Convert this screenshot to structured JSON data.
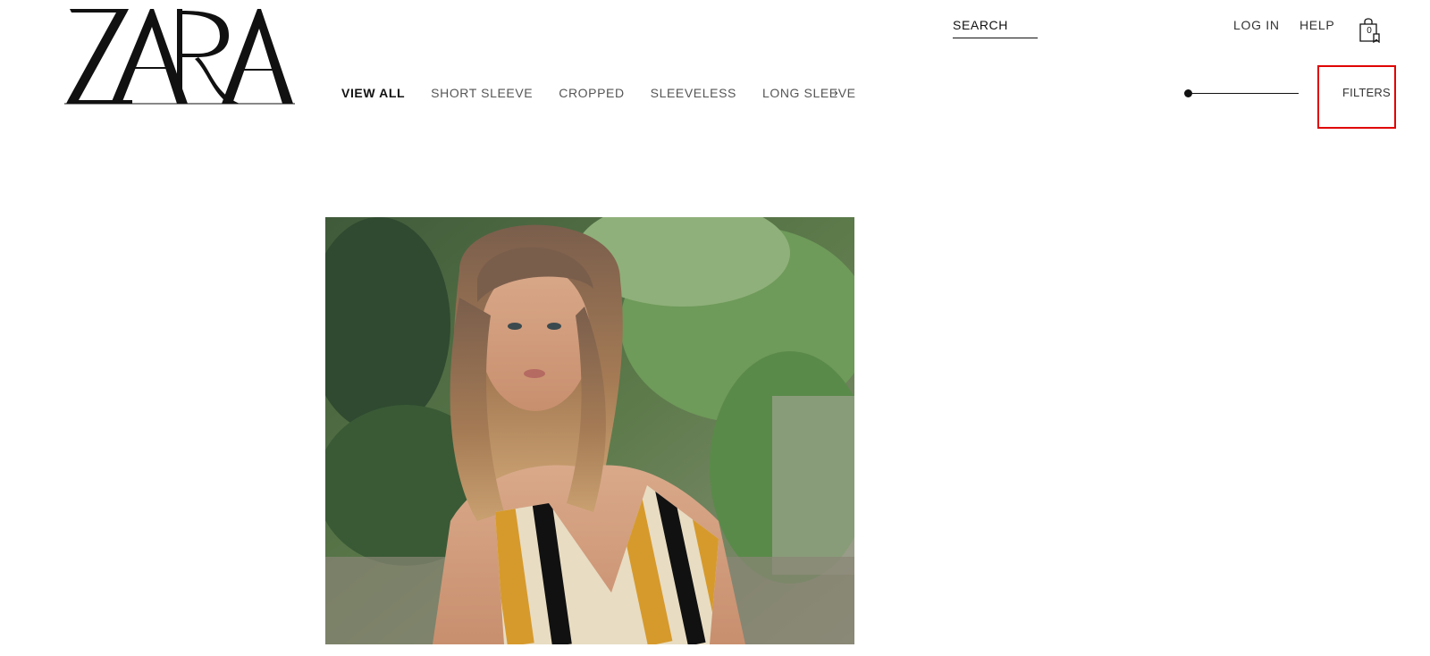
{
  "brand": {
    "logo_text": "ZARA"
  },
  "header": {
    "search_label": "SEARCH",
    "login_label": "LOG IN",
    "help_label": "HELP",
    "cart_count": "0"
  },
  "category_nav": {
    "items": [
      {
        "label": "VIEW ALL",
        "active": true
      },
      {
        "label": "SHORT SLEEVE",
        "active": false
      },
      {
        "label": "CROPPED",
        "active": false
      },
      {
        "label": "SLEEVELESS",
        "active": false
      },
      {
        "label": "LONG SLEEVE",
        "active": false
      }
    ],
    "next_glyph": "›"
  },
  "toolbar": {
    "zoom_level": 0,
    "filters_label": "FILTERS",
    "highlight_color": "#e00000"
  },
  "icons": {
    "cart": "shopping-bag-icon",
    "next": "chevron-right-icon"
  }
}
